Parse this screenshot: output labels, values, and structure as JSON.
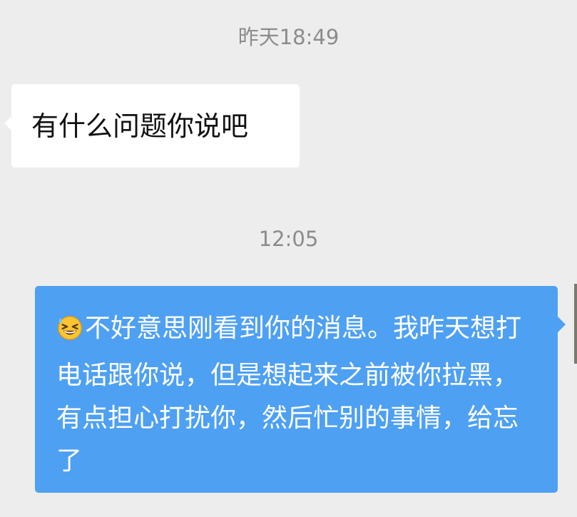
{
  "chat": {
    "timestamps": [
      "昨天18:49",
      "12:05"
    ],
    "messages": [
      {
        "direction": "incoming",
        "text": "有什么问题你说吧"
      },
      {
        "direction": "outgoing",
        "emoji": "grinning-squinting-sweat-emoji",
        "text": "不好意思刚看到你的消息。我昨天想打电话跟你说，但是想起来之前被你拉黑，有点担心打扰你，然后忙别的事情，给忘了"
      }
    ]
  },
  "colors": {
    "background": "#ededed",
    "incoming_bubble": "#ffffff",
    "outgoing_bubble": "#4ea0f2",
    "timestamp_text": "#8c8c8c"
  }
}
